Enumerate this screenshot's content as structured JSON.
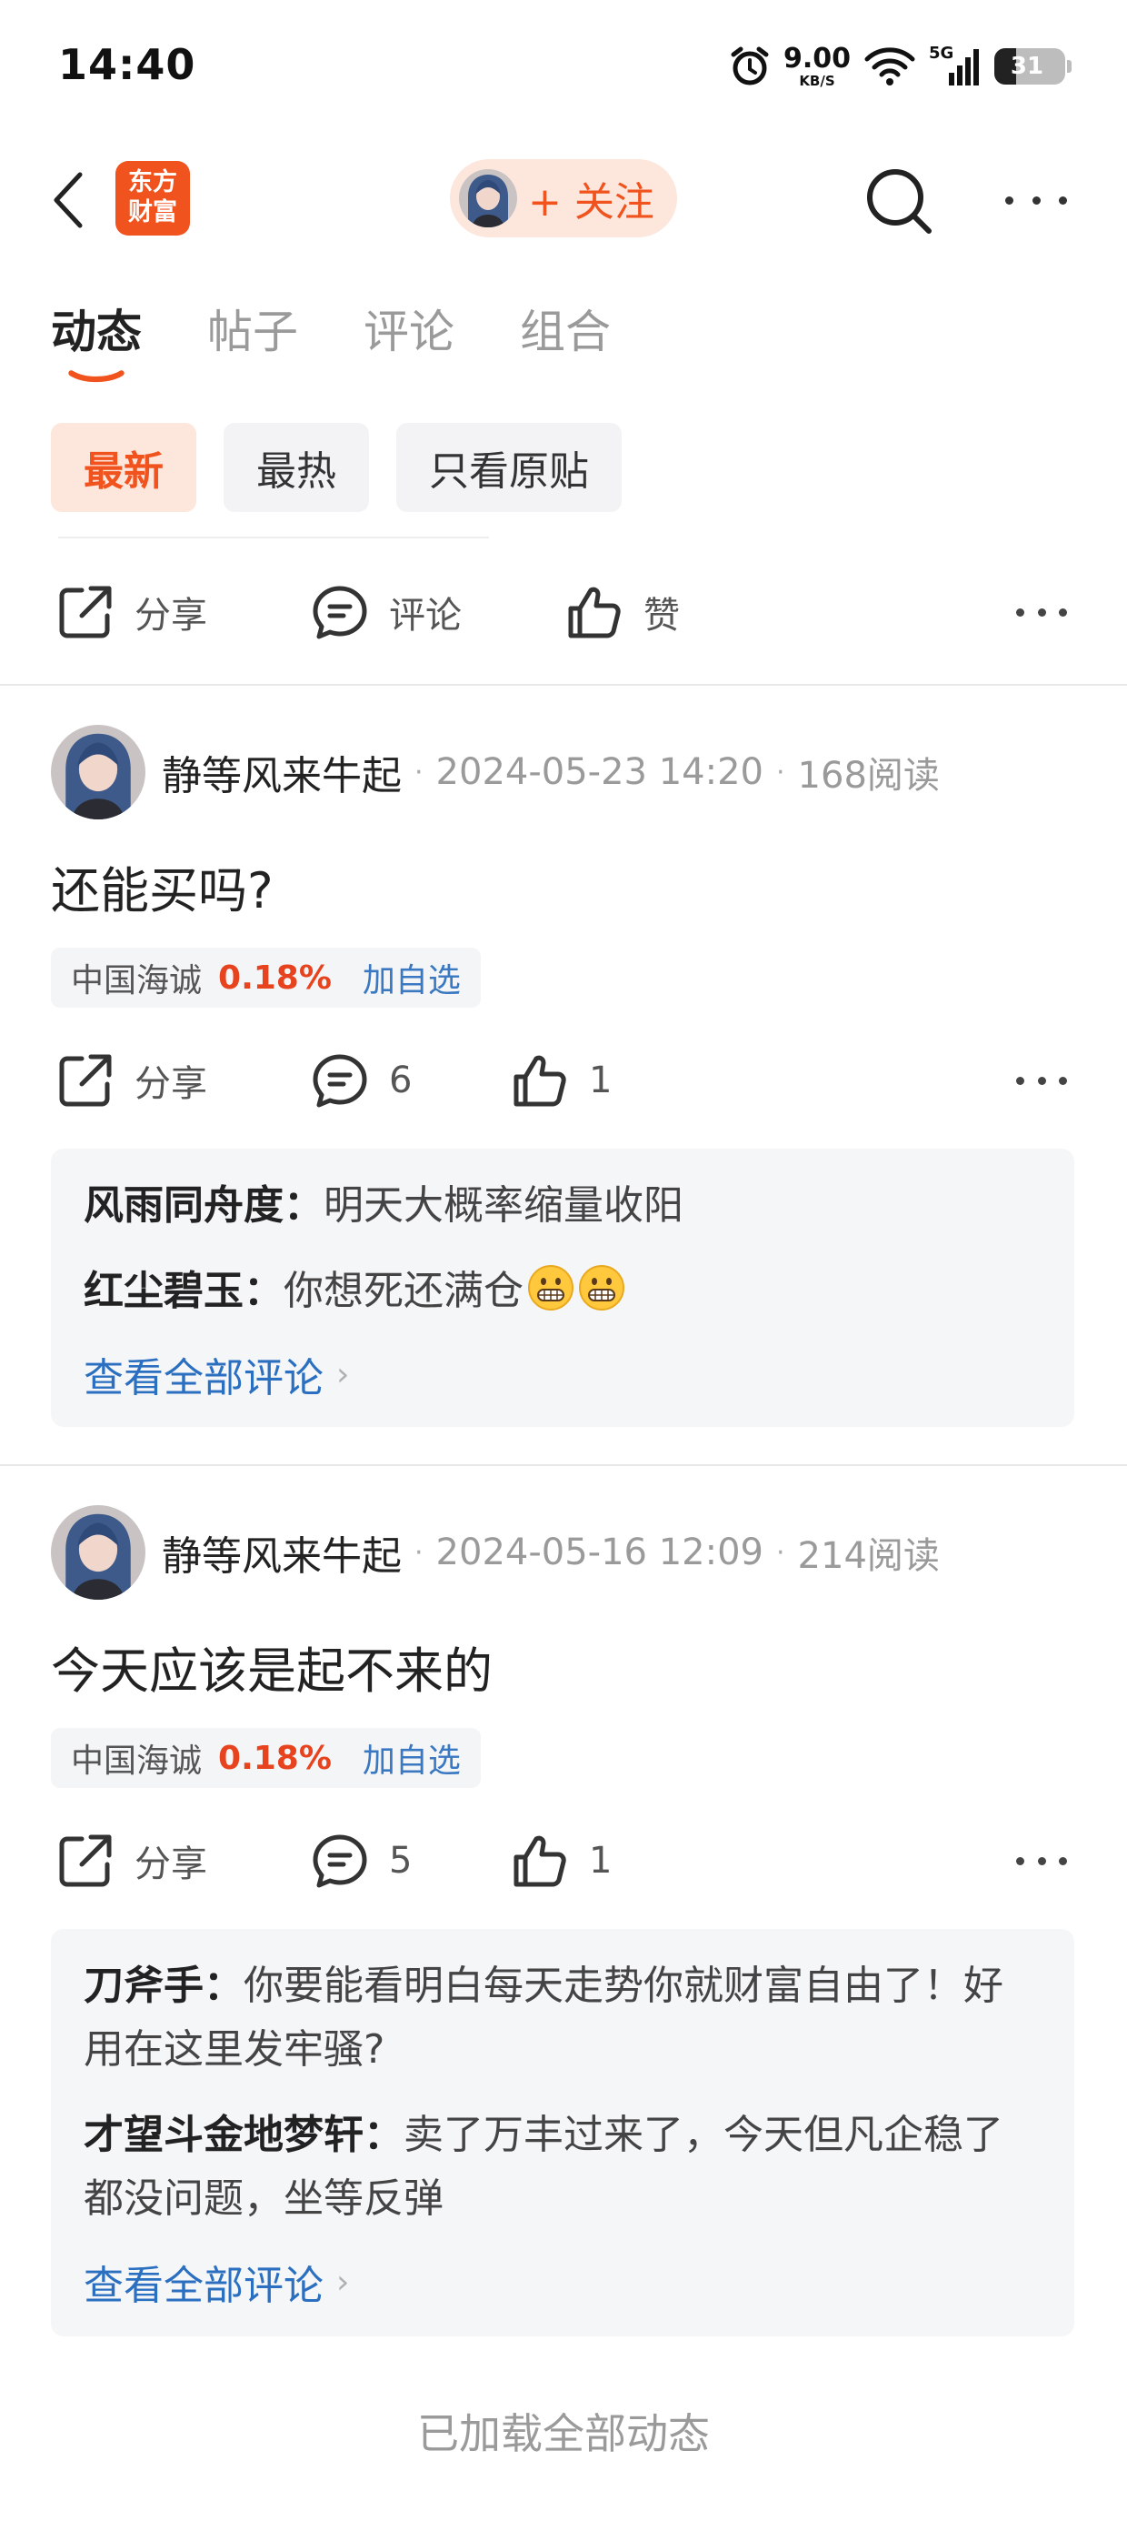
{
  "status_bar": {
    "time": "14:40",
    "net_speed_value": "9.00",
    "net_speed_unit": "KB/S",
    "network": "5G",
    "battery": "31"
  },
  "header": {
    "logo_text_line1": "东方",
    "logo_text_line2": "财富",
    "follow_label": "+ 关注",
    "brand_color": "#f0531e"
  },
  "tabs": [
    "动态",
    "帖子",
    "评论",
    "组合"
  ],
  "active_tab": "动态",
  "filters": [
    "最新",
    "最热",
    "只看原贴"
  ],
  "active_filter": "最新",
  "top_actions": {
    "share": "分享",
    "comment": "评论",
    "like": "赞"
  },
  "posts": [
    {
      "author": "静等风来牛起",
      "datetime": "2024-05-23 14:20",
      "reads": "168阅读",
      "text": "还能买吗?",
      "stock": {
        "name": "中国海诚",
        "change": "0.18%",
        "add": "加自选"
      },
      "share_label": "分享",
      "comment_count": "6",
      "like_count": "1",
      "comments": [
        {
          "user": "风雨同舟度：",
          "text": "明天大概率缩量收阳"
        },
        {
          "user": "红尘碧玉：",
          "text": "你想死还满仓"
        }
      ],
      "view_all": "查看全部评论"
    },
    {
      "author": "静等风来牛起",
      "datetime": "2024-05-16 12:09",
      "reads": "214阅读",
      "text": "今天应该是起不来的",
      "stock": {
        "name": "中国海诚",
        "change": "0.18%",
        "add": "加自选"
      },
      "share_label": "分享",
      "comment_count": "5",
      "like_count": "1",
      "comments": [
        {
          "user": "刀斧手：",
          "text": "你要能看明白每天走势你就财富自由了！好用在这里发牢骚?"
        },
        {
          "user": "才望斗金地梦轩：",
          "text": "卖了万丰过来了，今天但凡企稳了都没问题，坐等反弹"
        }
      ],
      "view_all": "查看全部评论"
    }
  ],
  "footer": "已加载全部动态"
}
